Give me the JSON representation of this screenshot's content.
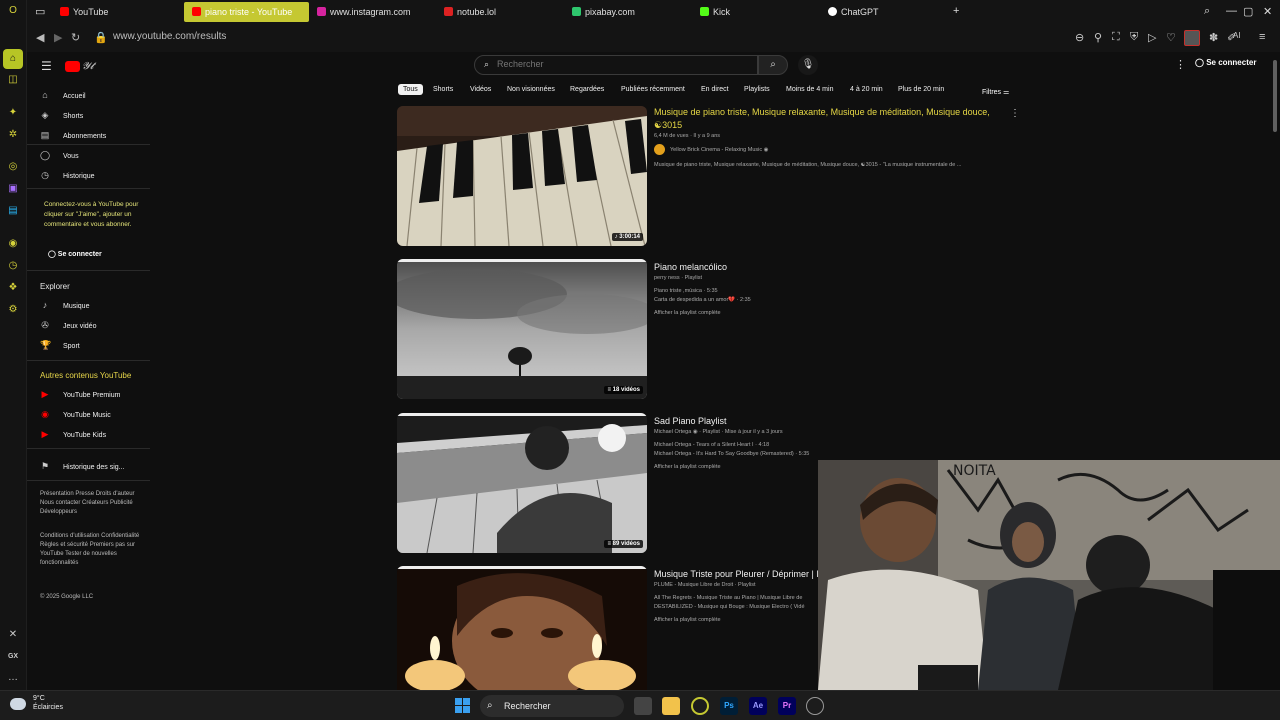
{
  "browser": {
    "tabs": [
      {
        "label": "YouTube",
        "color": "#ff0000"
      },
      {
        "label": "piano triste - YouTube",
        "color": "#ff0000",
        "active": true
      },
      {
        "label": "www.instagram.com",
        "color": "#d6249f"
      },
      {
        "label": "notube.lol",
        "color": "#d11"
      },
      {
        "label": "pixabay.com",
        "color": "#2ec66d"
      },
      {
        "label": "Kick",
        "color": "#53fc18"
      },
      {
        "label": "ChatGPT",
        "color": "#ffffff"
      }
    ],
    "new_tab": "+",
    "url": "www.youtube.com/results",
    "ai_label": "AI"
  },
  "yt": {
    "search_placeholder": "Rechercher",
    "signin": "Se connecter",
    "guide": {
      "main": [
        "Accueil",
        "Shorts",
        "Abonnements",
        "Vous",
        "Historique"
      ],
      "note": "Connectez-vous à YouTube pour cliquer sur \"J'aime\", ajouter un commentaire et vous abonner.",
      "signin": "Se connecter",
      "explore_title": "Explorer",
      "explore": [
        "Musique",
        "Jeux vidéo",
        "Sport"
      ],
      "more_title": "Autres contenus YouTube",
      "more": [
        "YouTube Premium",
        "YouTube Music",
        "YouTube Kids"
      ],
      "report": "Historique des sig...",
      "footer1": "Présentation Presse Droits d'auteur Nous contacter Créateurs Publicité Développeurs",
      "footer2": "Conditions d'utilisation Confidentialité Règles et sécurité Premiers pas sur YouTube Tester de nouvelles fonctionnalités",
      "copyright": "© 2025 Google LLC"
    },
    "chips": [
      "Tous",
      "Shorts",
      "Vidéos",
      "Non visionnées",
      "Regardées",
      "Publiées récemment",
      "En direct",
      "Playlists",
      "Moins de 4 min",
      "4 à 20 min",
      "Plus de 20 min"
    ],
    "filters": "Filtres",
    "results": [
      {
        "title": "Musique de piano triste, Musique relaxante, Musique de méditation, Musique douce, ☯3015",
        "meta": "6,4 M de vues · Il y a 9 ans",
        "channel": "Yellow Brick Cinema - Relaxing Music ◉",
        "desc": "Musique de piano triste, Musique relaxante, Musique de méditation, Musique douce, ☯3015 - \"La musique instrumentale de ...",
        "badge": "♪ 3:00:14"
      },
      {
        "title": "Piano melancólico",
        "meta": "perry ness · Playlist",
        "lines": [
          "Piano triste ,música · 5:35",
          "Carta de despedida a un amor💔 · 2:35"
        ],
        "full": "Afficher la playlist complète",
        "badge": "≡ 18 vidéos"
      },
      {
        "title": "Sad Piano Playlist",
        "meta": "Michael Ortega ◉ · Playlist · Mise à jour il y a 3 jours",
        "lines": [
          "Michael Ortega - Tears of a Silent Heart I · 4:18",
          "Michael Ortega - It's Hard To Say Goodbye (Remastered) · 5:35"
        ],
        "full": "Afficher la playlist complète",
        "badge": "≡ 89 vidéos"
      },
      {
        "title": "Musique Triste pour Pleurer / Déprimer | I",
        "meta": "PLUME - Musique Libre de Droit · Playlist",
        "lines": [
          "All The Regrets - Musique Triste au Piano | Musique Libre de",
          "DESTABILIZED - Musique qui Bouge : Musique Electro ( Vidé"
        ],
        "full": "Afficher la playlist complète"
      }
    ]
  },
  "taskbar": {
    "temp": "9°C",
    "weather": "Éclaircies",
    "search": "Rechercher",
    "apps": [
      "Ps",
      "Ae",
      "Pr"
    ]
  }
}
